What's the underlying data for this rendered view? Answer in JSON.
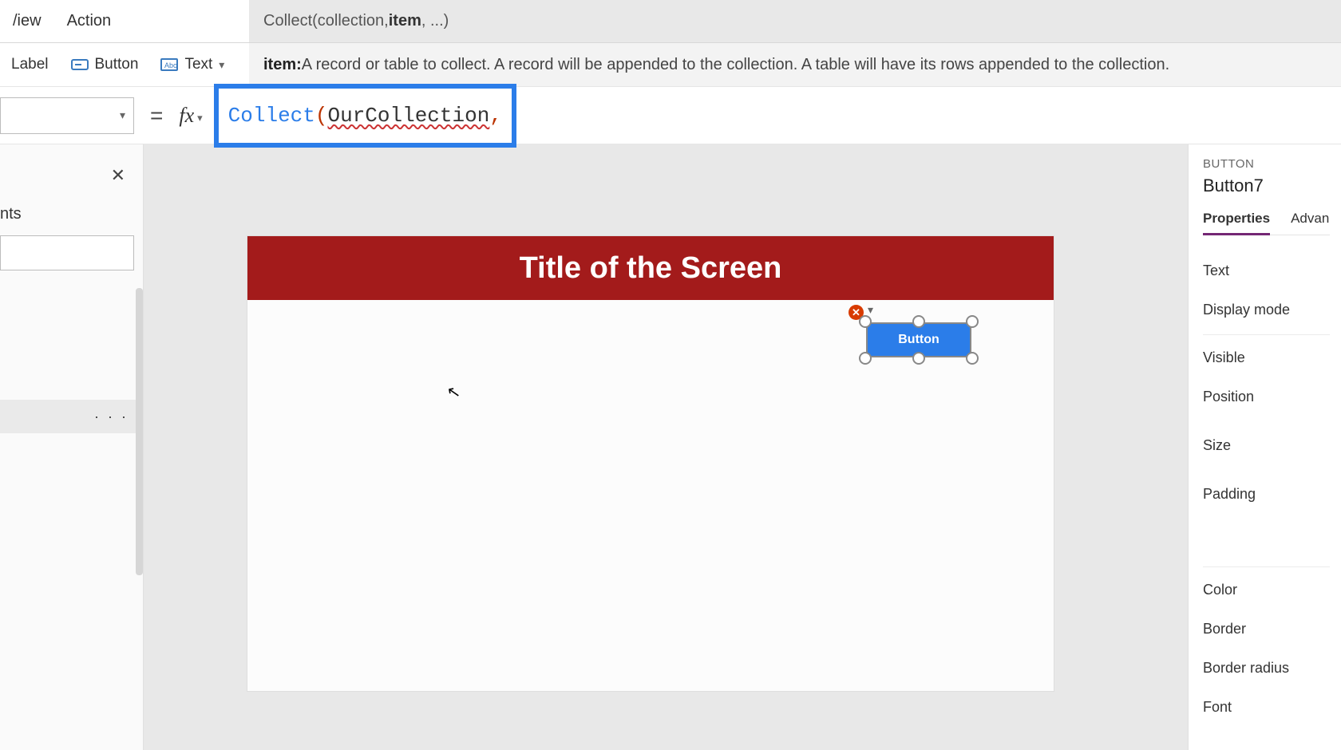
{
  "menu": {
    "view": "/iew",
    "action": "Action"
  },
  "intellisense_signature": {
    "prefix": "Collect(collection, ",
    "bold": "item",
    "suffix": ", ...)"
  },
  "ribbon": {
    "label_btn": "Label",
    "button_btn": "Button",
    "text_btn": "Text"
  },
  "param_help": {
    "label": "item:",
    "desc": " A record or table to collect. A record will be appended to the collection. A table will have its rows appended to the collection."
  },
  "formula": {
    "equals": "=",
    "fx": "fx",
    "fn": "Collect",
    "open": "(",
    "arg": "OurCollection",
    "comma": ","
  },
  "tree": {
    "heading": "nts",
    "more": "· · ·"
  },
  "canvas": {
    "screen_title": "Title of the Screen",
    "button_label": "Button",
    "error_x": "✕"
  },
  "props": {
    "kicker": "BUTTON",
    "name": "Button7",
    "tab_properties": "Properties",
    "tab_advanced": "Advan",
    "rows": {
      "text": "Text",
      "display_mode": "Display mode",
      "visible": "Visible",
      "position": "Position",
      "size": "Size",
      "padding": "Padding",
      "color": "Color",
      "border": "Border",
      "border_radius": "Border radius",
      "font": "Font"
    }
  }
}
